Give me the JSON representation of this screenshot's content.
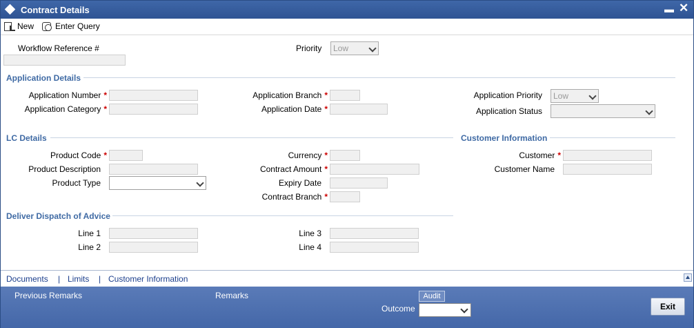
{
  "window": {
    "title": "Contract Details"
  },
  "toolbar": {
    "new_label": "New",
    "enter_query_label": "Enter Query"
  },
  "header": {
    "workflow_label": "Workflow Reference #",
    "workflow_value": "",
    "priority_label": "Priority",
    "priority_value": "Low"
  },
  "application": {
    "section_title": "Application Details",
    "number_label": "Application Number",
    "category_label": "Application Category",
    "branch_label": "Application Branch",
    "date_label": "Application Date",
    "priority_label": "Application Priority",
    "priority_value": "Low",
    "status_label": "Application Status",
    "status_value": ""
  },
  "lc": {
    "section_title": "LC Details",
    "product_code_label": "Product Code",
    "product_desc_label": "Product Description",
    "product_type_label": "Product Type",
    "product_type_value": "",
    "currency_label": "Currency",
    "contract_amount_label": "Contract Amount",
    "expiry_date_label": "Expiry Date",
    "contract_branch_label": "Contract Branch"
  },
  "customer": {
    "section_title": "Customer Information",
    "customer_label": "Customer",
    "customer_name_label": "Customer Name"
  },
  "advice": {
    "section_title": "Deliver Dispatch of Advice",
    "line1_label": "Line 1",
    "line2_label": "Line 2",
    "line3_label": "Line 3",
    "line4_label": "Line 4"
  },
  "required_marker": "*",
  "links": {
    "documents": "Documents",
    "limits": "Limits",
    "customer_information": "Customer Information",
    "separator": "|"
  },
  "footer": {
    "previous_remarks_label": "Previous Remarks",
    "remarks_label": "Remarks",
    "audit_label": "Audit",
    "outcome_label": "Outcome",
    "outcome_value": "",
    "exit_label": "Exit"
  },
  "colors": {
    "titlebar": "#2e5393",
    "section_heading": "#3f6aa4",
    "required": "#cc0000",
    "footer": "#4a6cab"
  }
}
